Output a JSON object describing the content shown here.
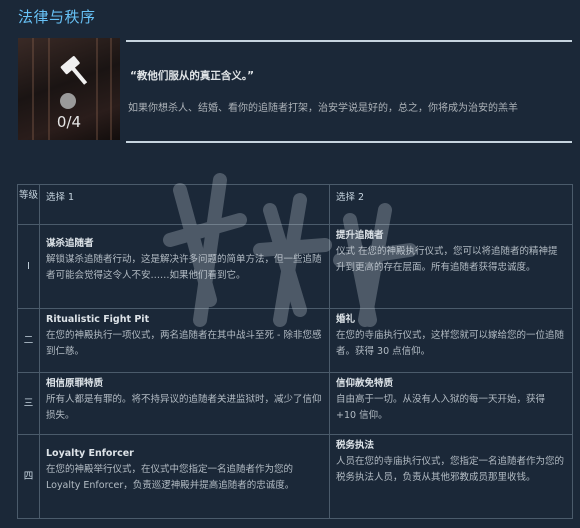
{
  "title": "法律与秩序",
  "hero": {
    "progress": "0/4",
    "quote": "“教他们服从的真正含义。”",
    "description": "如果你想杀人、结婚、看你的追随者打架，治安学说是好的，总之，你将成为治安的羔羊"
  },
  "table": {
    "headers": [
      "等级",
      "选择 1",
      "选择 2"
    ],
    "rows": [
      {
        "level": "Ⅰ",
        "opt1_title": "谋杀追随者",
        "opt1_desc": "解锁谋杀追随者行动，这是解决许多问题的简单方法，但一些追随者可能会觉得这令人不安……如果他们看到它。",
        "opt2_title": "提升追随者",
        "opt2_desc": "仪式 在您的神殿执行仪式，您可以将追随者的精神提升到更高的存在层面。所有追随者获得忠诚度。"
      },
      {
        "level": "二",
        "opt1_title": "Ritualistic Fight Pit",
        "opt1_desc": "在您的神殿执行一项仪式，两名追随者在其中战斗至死 - 除非您感到仁慈。",
        "opt2_title": "婚礼",
        "opt2_desc": "在您的寺庙执行仪式，这样您就可以嫁给您的一位追随者。获得 30 点信仰。"
      },
      {
        "level": "三",
        "opt1_title": "相信原罪特质",
        "opt1_desc": "所有人都是有罪的。将不持异议的追随者关进监狱时，减少了信仰损失。",
        "opt2_title": "信仰赦免特质",
        "opt2_desc": "自由高于一切。从没有人入狱的每一天开始，获得 +10 信仰。"
      },
      {
        "level": "四",
        "opt1_title": "Loyalty Enforcer",
        "opt1_desc": "在您的神殿举行仪式，在仪式中您指定一名追随者作为您的 Loyalty Enforcer，负责巡逻神殿并提高追随者的忠诚度。",
        "opt2_title": "税务执法",
        "opt2_desc": "人员在您的寺庙执行仪式，您指定一名追随者作为您的税务执法人员，负责从其他邪教成员那里收钱。"
      }
    ]
  }
}
